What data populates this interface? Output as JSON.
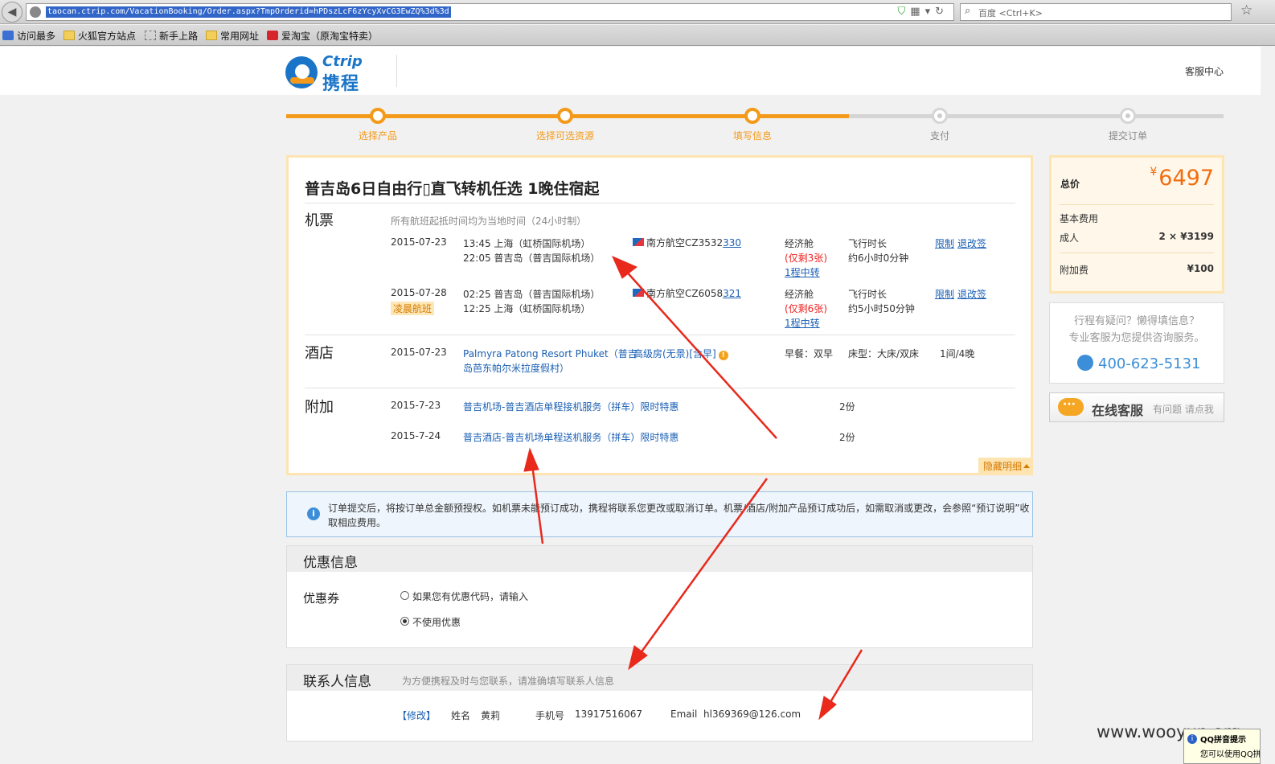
{
  "browser": {
    "url": "taocan.ctrip.com/VacationBooking/Order.aspx?TmpOrderid=hPDszLcF6zYcyXvCG3EwZQ%3d%3d",
    "search_placeholder": "百度 <Ctrl+K>"
  },
  "bookmarks": [
    {
      "label": "访问最多",
      "icon": "frequent-icon"
    },
    {
      "label": "火狐官方站点",
      "icon": "folder-icon"
    },
    {
      "label": "新手上路",
      "icon": "page-icon"
    },
    {
      "label": "常用网址",
      "icon": "folder-icon"
    },
    {
      "label": "爱淘宝（原淘宝特卖）",
      "icon": "aitaobao-icon"
    }
  ],
  "header": {
    "logo_en": "Ctrip",
    "logo_cn": "携程",
    "service_center": "客服中心"
  },
  "steps": [
    {
      "label": "选择产品",
      "done": true
    },
    {
      "label": "选择可选资源",
      "done": true
    },
    {
      "label": "填写信息",
      "done": true
    },
    {
      "label": "支付",
      "done": false
    },
    {
      "label": "提交订单",
      "done": false
    }
  ],
  "order": {
    "title": "普吉岛6日自由行▯直飞转机任选 1晚住宿起",
    "flight": {
      "label": "机票",
      "note": "所有航班起抵时间均为当地时间（24小时制）",
      "segments": [
        {
          "date": "2015-07-23",
          "dep": "13:45 上海（虹桥国际机场）",
          "arr": "22:05 普吉岛（普吉国际机场）",
          "airline": "南方航空CZ3532",
          "flight_link": "330",
          "cabin": "经济舱",
          "remain": "(仅剩3张)",
          "transfer": "1程中转",
          "duration_label": "飞行时长",
          "duration": "约6小时0分钟",
          "restrict": "限制",
          "change": "退改签"
        },
        {
          "date": "2015-07-28",
          "tag": "凌晨航班",
          "dep": "02:25 普吉岛（普吉国际机场）",
          "arr": "12:25 上海（虹桥国际机场）",
          "airline": "南方航空CZ6058",
          "flight_link": "321",
          "cabin": "经济舱",
          "remain": "(仅剩6张)",
          "transfer": "1程中转",
          "duration_label": "飞行时长",
          "duration": "约5小时50分钟",
          "restrict": "限制",
          "change": "退改签"
        }
      ]
    },
    "hotel": {
      "label": "酒店",
      "date": "2015-07-23",
      "name_line1": "Palmyra Patong Resort Phuket（普吉",
      "name_line2": "岛芭东帕尔米拉度假村）",
      "room": "高级房(无景)[含早]",
      "breakfast": "早餐：双早",
      "bed": "床型：大床/双床",
      "nights": "1间/4晚"
    },
    "extras": {
      "label": "附加",
      "items": [
        {
          "date": "2015-7-23",
          "name": "普吉机场-普吉酒店单程接机服务（拼车）限时特惠",
          "qty": "2份"
        },
        {
          "date": "2015-7-24",
          "name": "普吉酒店-普吉机场单程送机服务（拼车）限时特惠",
          "qty": "2份"
        }
      ]
    },
    "hide_detail": "隐藏明细"
  },
  "notice": "订单提交后，将按订单总金额预授权。如机票未能预订成功，携程将联系您更改或取消订单。机票/酒店/附加产品预订成功后，如需取消或更改，会参照“预订说明”收取相应费用。",
  "coupon": {
    "title": "优惠信息",
    "label": "优惠券",
    "option1": "如果您有优惠代码，请输入",
    "option2": "不使用优惠",
    "selected": 2
  },
  "contact": {
    "title": "联系人信息",
    "hint": "为方便携程及时与您联系，请准确填写联系人信息",
    "edit": "【修改】",
    "name_label": "姓名",
    "name": "黄莉",
    "phone_label": "手机号",
    "phone": "13917516067",
    "email_label": "Email",
    "email": "hl369369@126.com"
  },
  "price": {
    "total_label": "总价",
    "currency": "¥",
    "total": "6497",
    "base_label": "基本费用",
    "adult_label": "成人",
    "adult_value": "2 × ¥3199",
    "extra_label": "附加费",
    "extra_value": "¥100"
  },
  "help": {
    "line1": "行程有疑问？懒得填信息？",
    "line2": "专业客服为您提供咨询服务。",
    "phone": "400-623-5131"
  },
  "chat": {
    "label": "在线客服",
    "sub": "有问题 请点我"
  },
  "watermark": "www.wooyun.org",
  "ime": {
    "title": "QQ拼音提示",
    "sub": "您可以使用QQ拼"
  },
  "colors": {
    "accent": "#f39a1b",
    "link": "#1a5fb4",
    "price": "#f06d10",
    "annotation": "#e8291c"
  }
}
